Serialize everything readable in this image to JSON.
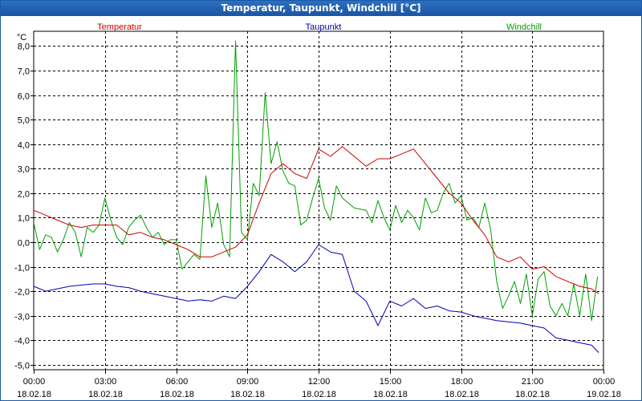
{
  "window": {
    "title": "Temperatur, Taupunkt, Windchill [°C]"
  },
  "chart_data": {
    "type": "line",
    "title": "Temperatur, Taupunkt, Windchill [°C]",
    "unit_label": "°C",
    "ylim": [
      -5.2,
      8.6
    ],
    "y_ticks": [
      "8,0",
      "7,0",
      "6,0",
      "5,0",
      "4,0",
      "3,0",
      "2,0",
      "1,0",
      "0,0",
      "-1,0",
      "-2,0",
      "-3,0",
      "-4,0",
      "-5,0"
    ],
    "y_tick_values": [
      8,
      7,
      6,
      5,
      4,
      3,
      2,
      1,
      0,
      -1,
      -2,
      -3,
      -4,
      -5
    ],
    "xlim": [
      0,
      24
    ],
    "x_ticks": [
      {
        "time": "00:00",
        "date": "18.02.18"
      },
      {
        "time": "03:00",
        "date": "18.02.18"
      },
      {
        "time": "06:00",
        "date": "18.02.18"
      },
      {
        "time": "09:00",
        "date": "18.02.18"
      },
      {
        "time": "12:00",
        "date": "18.02.18"
      },
      {
        "time": "15:00",
        "date": "18.02.18"
      },
      {
        "time": "18:00",
        "date": "18.02.18"
      },
      {
        "time": "21:00",
        "date": "18.02.18"
      },
      {
        "time": "00:00",
        "date": "19.02.18"
      }
    ],
    "x_tick_hours": [
      0,
      3,
      6,
      9,
      12,
      15,
      18,
      21,
      24
    ],
    "grid": true,
    "legend_position": "top",
    "series": [
      {
        "name": "Temperatur",
        "color": "#cc0000",
        "points": [
          [
            0,
            1.3
          ],
          [
            0.5,
            1.1
          ],
          [
            1,
            0.9
          ],
          [
            1.5,
            0.7
          ],
          [
            2,
            0.6
          ],
          [
            2.5,
            0.7
          ],
          [
            3,
            0.7
          ],
          [
            3.5,
            0.7
          ],
          [
            4,
            0.3
          ],
          [
            4.5,
            0.4
          ],
          [
            5,
            0.2
          ],
          [
            5.5,
            0.1
          ],
          [
            6,
            -0.1
          ],
          [
            6.5,
            -0.3
          ],
          [
            7,
            -0.6
          ],
          [
            7.5,
            -0.6
          ],
          [
            8,
            -0.4
          ],
          [
            8.5,
            -0.2
          ],
          [
            9,
            0.3
          ],
          [
            9.5,
            1.6
          ],
          [
            10,
            2.8
          ],
          [
            10.5,
            3.2
          ],
          [
            11,
            2.8
          ],
          [
            11.5,
            2.6
          ],
          [
            12,
            3.8
          ],
          [
            12.5,
            3.5
          ],
          [
            13,
            3.9
          ],
          [
            13.5,
            3.5
          ],
          [
            14,
            3.1
          ],
          [
            14.5,
            3.4
          ],
          [
            15,
            3.4
          ],
          [
            15.5,
            3.6
          ],
          [
            16,
            3.8
          ],
          [
            16.5,
            3.2
          ],
          [
            17,
            2.6
          ],
          [
            17.5,
            2.0
          ],
          [
            18,
            1.6
          ],
          [
            18.5,
            0.9
          ],
          [
            19,
            0.3
          ],
          [
            19.5,
            -0.6
          ],
          [
            20,
            -0.8
          ],
          [
            20.5,
            -0.6
          ],
          [
            21,
            -1.1
          ],
          [
            21.5,
            -1.0
          ],
          [
            22,
            -1.4
          ],
          [
            22.5,
            -1.6
          ],
          [
            23,
            -1.8
          ],
          [
            23.5,
            -1.9
          ],
          [
            23.8,
            -2.1
          ]
        ]
      },
      {
        "name": "Taupunkt",
        "color": "#0000b0",
        "points": [
          [
            0,
            -1.8
          ],
          [
            0.5,
            -2.0
          ],
          [
            1,
            -1.9
          ],
          [
            1.5,
            -1.8
          ],
          [
            2,
            -1.75
          ],
          [
            2.5,
            -1.7
          ],
          [
            3,
            -1.7
          ],
          [
            3.5,
            -1.8
          ],
          [
            4,
            -1.85
          ],
          [
            4.5,
            -2.0
          ],
          [
            5,
            -2.1
          ],
          [
            5.5,
            -2.2
          ],
          [
            6,
            -2.3
          ],
          [
            6.5,
            -2.4
          ],
          [
            7,
            -2.35
          ],
          [
            7.5,
            -2.4
          ],
          [
            8,
            -2.2
          ],
          [
            8.5,
            -2.3
          ],
          [
            9,
            -1.8
          ],
          [
            9.5,
            -1.2
          ],
          [
            10,
            -0.5
          ],
          [
            10.5,
            -0.8
          ],
          [
            11,
            -1.2
          ],
          [
            11.5,
            -0.8
          ],
          [
            12,
            -0.1
          ],
          [
            12.5,
            -0.4
          ],
          [
            13,
            -0.5
          ],
          [
            13.5,
            -2.0
          ],
          [
            14,
            -2.4
          ],
          [
            14.5,
            -3.4
          ],
          [
            15,
            -2.4
          ],
          [
            15.5,
            -2.6
          ],
          [
            16,
            -2.3
          ],
          [
            16.5,
            -2.7
          ],
          [
            17,
            -2.6
          ],
          [
            17.5,
            -2.8
          ],
          [
            18,
            -2.85
          ],
          [
            18.5,
            -3.0
          ],
          [
            19,
            -3.1
          ],
          [
            19.5,
            -3.2
          ],
          [
            20,
            -3.25
          ],
          [
            20.5,
            -3.3
          ],
          [
            21,
            -3.4
          ],
          [
            21.5,
            -3.5
          ],
          [
            22,
            -3.9
          ],
          [
            22.5,
            -4.0
          ],
          [
            23,
            -4.1
          ],
          [
            23.5,
            -4.2
          ],
          [
            23.8,
            -4.5
          ]
        ]
      },
      {
        "name": "Windchill",
        "color": "#00a000",
        "points": [
          [
            0,
            0.8
          ],
          [
            0.25,
            -0.3
          ],
          [
            0.5,
            0.3
          ],
          [
            0.75,
            0.2
          ],
          [
            1,
            -0.4
          ],
          [
            1.25,
            0.1
          ],
          [
            1.5,
            0.8
          ],
          [
            1.75,
            0.4
          ],
          [
            2,
            -0.6
          ],
          [
            2.25,
            0.6
          ],
          [
            2.5,
            0.4
          ],
          [
            2.75,
            0.7
          ],
          [
            3,
            1.8
          ],
          [
            3.25,
            0.9
          ],
          [
            3.5,
            0.2
          ],
          [
            3.75,
            -0.1
          ],
          [
            4,
            0.6
          ],
          [
            4.25,
            0.9
          ],
          [
            4.5,
            1.1
          ],
          [
            4.75,
            0.6
          ],
          [
            5,
            0.2
          ],
          [
            5.25,
            0.4
          ],
          [
            5.5,
            -0.1
          ],
          [
            5.75,
            0.1
          ],
          [
            6,
            0.1
          ],
          [
            6.25,
            -1.1
          ],
          [
            6.5,
            -0.8
          ],
          [
            6.75,
            -0.5
          ],
          [
            7,
            -0.7
          ],
          [
            7.25,
            2.7
          ],
          [
            7.5,
            0.6
          ],
          [
            7.75,
            1.6
          ],
          [
            8,
            -0.1
          ],
          [
            8.25,
            -0.6
          ],
          [
            8.5,
            8.2
          ],
          [
            8.75,
            0.4
          ],
          [
            9,
            0.1
          ],
          [
            9.25,
            2.4
          ],
          [
            9.5,
            1.9
          ],
          [
            9.75,
            6.1
          ],
          [
            10,
            3.2
          ],
          [
            10.25,
            4.1
          ],
          [
            10.5,
            2.9
          ],
          [
            10.75,
            2.4
          ],
          [
            11,
            2.3
          ],
          [
            11.25,
            0.7
          ],
          [
            11.5,
            0.9
          ],
          [
            11.75,
            1.8
          ],
          [
            12,
            2.6
          ],
          [
            12.25,
            1.4
          ],
          [
            12.5,
            0.9
          ],
          [
            12.75,
            2.3
          ],
          [
            13,
            1.8
          ],
          [
            13.5,
            1.4
          ],
          [
            14,
            1.3
          ],
          [
            14.25,
            0.8
          ],
          [
            14.5,
            1.7
          ],
          [
            14.75,
            1.0
          ],
          [
            15,
            0.5
          ],
          [
            15.25,
            1.5
          ],
          [
            15.5,
            0.8
          ],
          [
            15.75,
            1.3
          ],
          [
            16,
            1.0
          ],
          [
            16.25,
            0.5
          ],
          [
            16.5,
            1.8
          ],
          [
            16.75,
            1.2
          ],
          [
            17,
            1.3
          ],
          [
            17.25,
            2.0
          ],
          [
            17.5,
            2.4
          ],
          [
            17.75,
            1.6
          ],
          [
            18,
            1.9
          ],
          [
            18.25,
            0.9
          ],
          [
            18.5,
            1.0
          ],
          [
            18.75,
            0.6
          ],
          [
            19,
            1.6
          ],
          [
            19.25,
            0.5
          ],
          [
            19.5,
            -1.6
          ],
          [
            19.75,
            -2.7
          ],
          [
            20,
            -2.2
          ],
          [
            20.25,
            -1.6
          ],
          [
            20.5,
            -2.5
          ],
          [
            20.75,
            -1.3
          ],
          [
            21,
            -3.0
          ],
          [
            21.25,
            -1.5
          ],
          [
            21.5,
            -1.2
          ],
          [
            21.75,
            -2.6
          ],
          [
            22,
            -3.0
          ],
          [
            22.25,
            -2.5
          ],
          [
            22.5,
            -3.0
          ],
          [
            22.75,
            -1.7
          ],
          [
            23,
            -3.0
          ],
          [
            23.25,
            -1.3
          ],
          [
            23.5,
            -3.2
          ],
          [
            23.75,
            -1.4
          ]
        ]
      }
    ]
  }
}
